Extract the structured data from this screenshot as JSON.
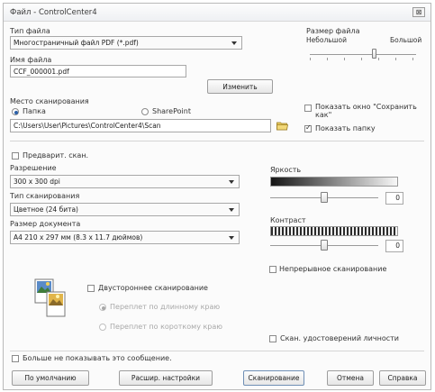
{
  "window": {
    "title": "Файл - ControlCenter4",
    "close_label": "⊠"
  },
  "file_type": {
    "label": "Тип файла",
    "value": "Многостраничный файл PDF (*.pdf)"
  },
  "file_size": {
    "label": "Размер файла",
    "small": "Небольшой",
    "large": "Большой",
    "level": 0.6
  },
  "file_name": {
    "label": "Имя файла",
    "value": "CCF_000001.pdf",
    "change_button": "Изменить"
  },
  "scan_location": {
    "label": "Место сканирования",
    "folder": "Папка",
    "sharepoint": "SharePoint",
    "selected": "Папка",
    "path": "C:\\Users\\User\\Pictures\\ControlCenter4\\Scan",
    "show_save_as": "Показать окно \"Сохранить как\"",
    "show_save_as_checked": false,
    "show_folder": "Показать папку",
    "show_folder_checked": true
  },
  "prescan": {
    "label": "Предварит. скан.",
    "checked": false
  },
  "resolution": {
    "label": "Разрешение",
    "value": "300 x 300 dpi"
  },
  "scan_type": {
    "label": "Тип сканирования",
    "value": "Цветное (24 бита)"
  },
  "document_size": {
    "label": "Размер документа",
    "value": "A4 210 x 297 мм (8.3 x 11.7 дюймов)"
  },
  "brightness": {
    "label": "Яркость",
    "value": "0"
  },
  "contrast": {
    "label": "Контраст",
    "value": "0"
  },
  "continuous_scan": {
    "label": "Непрерывное сканирование",
    "checked": false
  },
  "duplex": {
    "label": "Двустороннее сканирование",
    "checked": false,
    "long_edge": "Переплет по длинному краю",
    "short_edge": "Переплет по короткому краю",
    "selected": "long_edge"
  },
  "id_card_scan": {
    "label": "Скан. удостоверений личности",
    "checked": false
  },
  "dont_show": {
    "label": "Больше не показывать это сообщение.",
    "checked": false
  },
  "buttons": {
    "default": "По умолчанию",
    "advanced": "Расшир. настройки",
    "scan": "Сканирование",
    "cancel": "Отмена",
    "help": "Справка"
  }
}
